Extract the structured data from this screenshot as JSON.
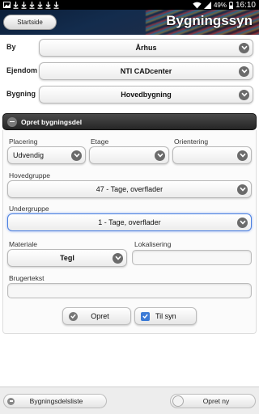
{
  "status_bar": {
    "battery": "49%",
    "time": "16:10"
  },
  "header": {
    "back_label": "Startside",
    "title": "Bygningssyn"
  },
  "selectors": {
    "by": {
      "label": "By",
      "value": "Århus"
    },
    "ejendom": {
      "label": "Ejendom",
      "value": "NTI CADcenter"
    },
    "bygning": {
      "label": "Bygning",
      "value": "Hovedbygning"
    }
  },
  "section": {
    "title": "Opret bygningsdel",
    "placering": {
      "label": "Placering",
      "value": "Udvendig"
    },
    "etage": {
      "label": "Etage",
      "value": ""
    },
    "orientering": {
      "label": "Orientering",
      "value": ""
    },
    "hovedgruppe": {
      "label": "Hovedgruppe",
      "value": "47 - Tage, overflader"
    },
    "undergruppe": {
      "label": "Undergruppe",
      "value": "1 - Tage, overflader"
    },
    "materiale": {
      "label": "Materiale",
      "value": "Tegl"
    },
    "lokalisering": {
      "label": "Lokalisering",
      "value": ""
    },
    "brugertekst": {
      "label": "Brugertekst",
      "value": ""
    },
    "opret_label": "Opret",
    "til_syn_label": "Til syn",
    "til_syn_checked": true
  },
  "footer": {
    "list_label": "Bygningsdelsliste",
    "new_label": "Opret ny"
  },
  "colors": {
    "header_bg": "#132c4d",
    "section_bar": "#262626",
    "focus": "#4a7fe0",
    "checkbox": "#3c7bd6"
  }
}
